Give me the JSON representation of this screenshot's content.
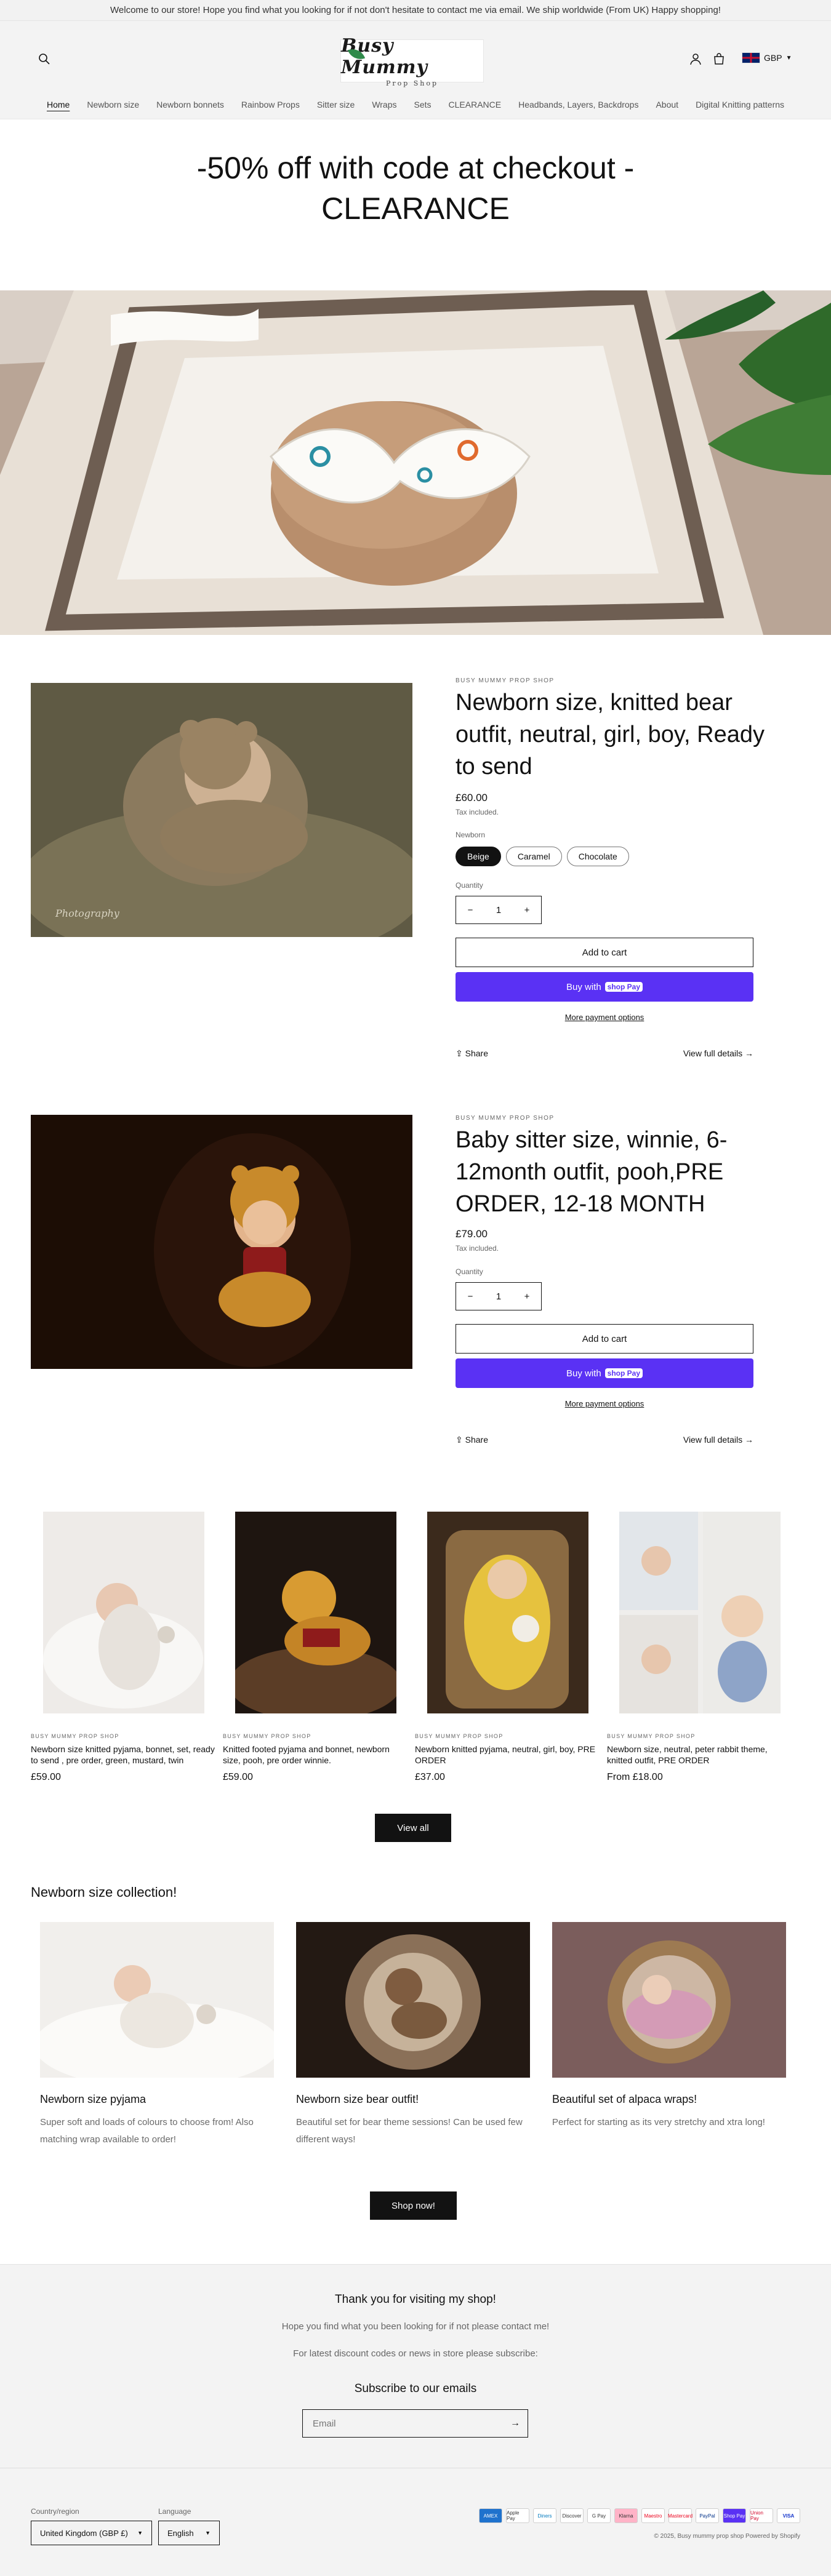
{
  "announcement": "Welcome to our store! Hope you find what you looking for if not don't hesitate to contact me via email. We ship worldwide (From UK) Happy shopping!",
  "logo": {
    "name": "Busy Mummy",
    "sub": "Prop Shop"
  },
  "header": {
    "currency": "GBP"
  },
  "nav": [
    "Home",
    "Newborn size",
    "Newborn bonnets",
    "Rainbow Props",
    "Sitter size",
    "Wraps",
    "Sets",
    "CLEARANCE",
    "Headbands, Layers, Backdrops",
    "About",
    "Digital Knitting patterns"
  ],
  "banner": {
    "line1": "-50% off with code at checkout -",
    "line2": "CLEARANCE"
  },
  "product1": {
    "vendor": "BUSY MUMMY PROP SHOP",
    "title": "Newborn size, knitted bear outfit, neutral, girl, boy, Ready to send",
    "price": "£60.00",
    "tax": "Tax included.",
    "option_label": "Newborn",
    "options": [
      "Beige",
      "Caramel",
      "Chocolate"
    ],
    "quantity_label": "Quantity",
    "quantity": "1",
    "add_to_cart": "Add to cart",
    "buy_with": "Buy with",
    "shop_pay": "shop Pay",
    "more_payment": "More payment options",
    "share": "Share",
    "view_details": "View full details"
  },
  "product2": {
    "vendor": "BUSY MUMMY PROP SHOP",
    "title": "Baby sitter size, winnie, 6-12month outfit, pooh,PRE ORDER, 12-18 MONTH",
    "price": "£79.00",
    "tax": "Tax included.",
    "quantity_label": "Quantity",
    "quantity": "1",
    "add_to_cart": "Add to cart",
    "buy_with": "Buy with",
    "shop_pay": "shop Pay",
    "more_payment": "More payment options",
    "share": "Share",
    "view_details": "View full details"
  },
  "grid": [
    {
      "vendor": "BUSY MUMMY PROP SHOP",
      "title": "Newborn size knitted pyjama, bonnet, set, ready to send , pre order, green, mustard, twin",
      "price": "£59.00"
    },
    {
      "vendor": "BUSY MUMMY PROP SHOP",
      "title": "Knitted footed pyjama and bonnet, newborn size, pooh, pre order winnie.",
      "price": "£59.00"
    },
    {
      "vendor": "BUSY MUMMY PROP SHOP",
      "title": "Newborn knitted pyjama, neutral, girl, boy, PRE ORDER",
      "price": "£37.00"
    },
    {
      "vendor": "BUSY MUMMY PROP SHOP",
      "title": "Newborn size, neutral, peter rabbit theme, knitted outfit, PRE ORDER",
      "price": "From £18.00"
    }
  ],
  "view_all": "View all",
  "collection": {
    "heading": "Newborn size collection!",
    "items": [
      {
        "title": "Newborn size pyjama",
        "desc": "Super soft and loads of colours to choose from! Also matching wrap available to order!"
      },
      {
        "title": "Newborn size bear outfit!",
        "desc": "Beautiful set for bear theme sessions! Can be used few different ways!"
      },
      {
        "title": "Beautiful set of alpaca wraps!",
        "desc": "Perfect for starting as its very stretchy and xtra long!"
      }
    ],
    "button": "Shop now!"
  },
  "thanks": {
    "title": "Thank you for visiting my shop!",
    "line1": "Hope you find what you been looking for if not please contact me!",
    "line2": "For latest discount codes or news in store please subscribe:"
  },
  "newsletter": {
    "title": "Subscribe to our emails",
    "placeholder": "Email"
  },
  "footer": {
    "country_label": "Country/region",
    "country": "United Kingdom (GBP £)",
    "language_label": "Language",
    "language": "English",
    "copyright": "© 2025, Busy mummy prop shop  Powered by Shopify",
    "payments": [
      "AMEX",
      "Apple Pay",
      "Diners",
      "Discover",
      "G Pay",
      "Klarna",
      "Maestro",
      "Mastercard",
      "PayPal",
      "Shop Pay",
      "Union Pay",
      "VISA"
    ]
  },
  "colors": {
    "shop_pay": "#5a31f4",
    "dark": "#121212"
  }
}
